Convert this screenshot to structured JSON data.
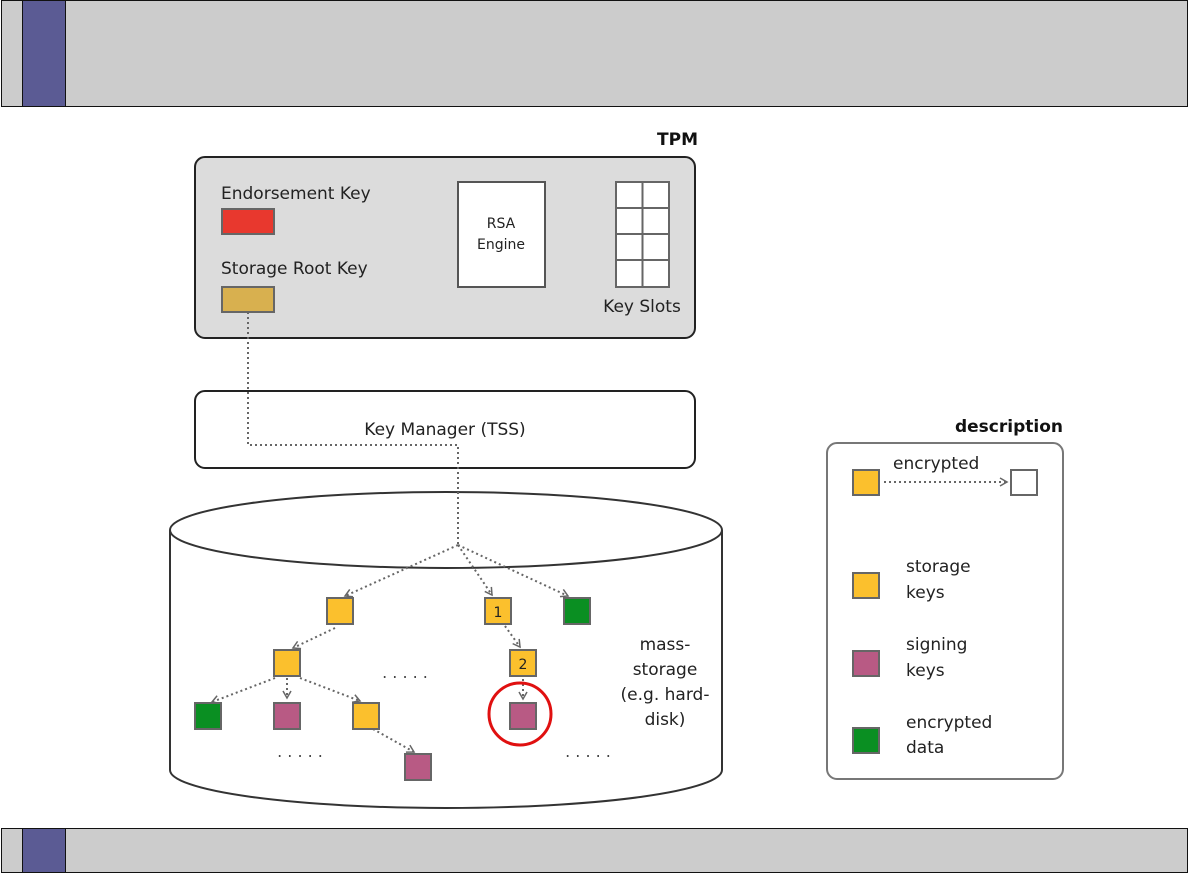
{
  "tpm": {
    "title": "TPM",
    "endorsement_key_label": "Endorsement Key",
    "storage_root_key_label": "Storage Root Key",
    "rsa_engine_line1": "RSA",
    "rsa_engine_line2": "Engine",
    "key_slots_label": "Key Slots"
  },
  "key_manager": {
    "label": "Key Manager (TSS)"
  },
  "storage": {
    "line1": "mass-",
    "line2": "storage",
    "line3": "(e.g. hard-",
    "line4": "disk)",
    "ellipsis": ". . . . .",
    "key_1": "1",
    "key_2": "2"
  },
  "legend": {
    "title": "description",
    "encrypted_label": "encrypted",
    "storage_keys_line1": "storage",
    "storage_keys_line2": "keys",
    "signing_keys_line1": "signing",
    "signing_keys_line2": "keys",
    "encrypted_data_line1": "encrypted",
    "encrypted_data_line2": "data"
  },
  "colors": {
    "endorsement_key": "#e8382e",
    "storage_root_key": "#d8b04f",
    "storage_key": "#fbc02d",
    "signing_key": "#b85a84",
    "encrypted_data": "#0a8f22",
    "highlight_circle": "#e01010",
    "slide_accent": "#5b5b94"
  }
}
